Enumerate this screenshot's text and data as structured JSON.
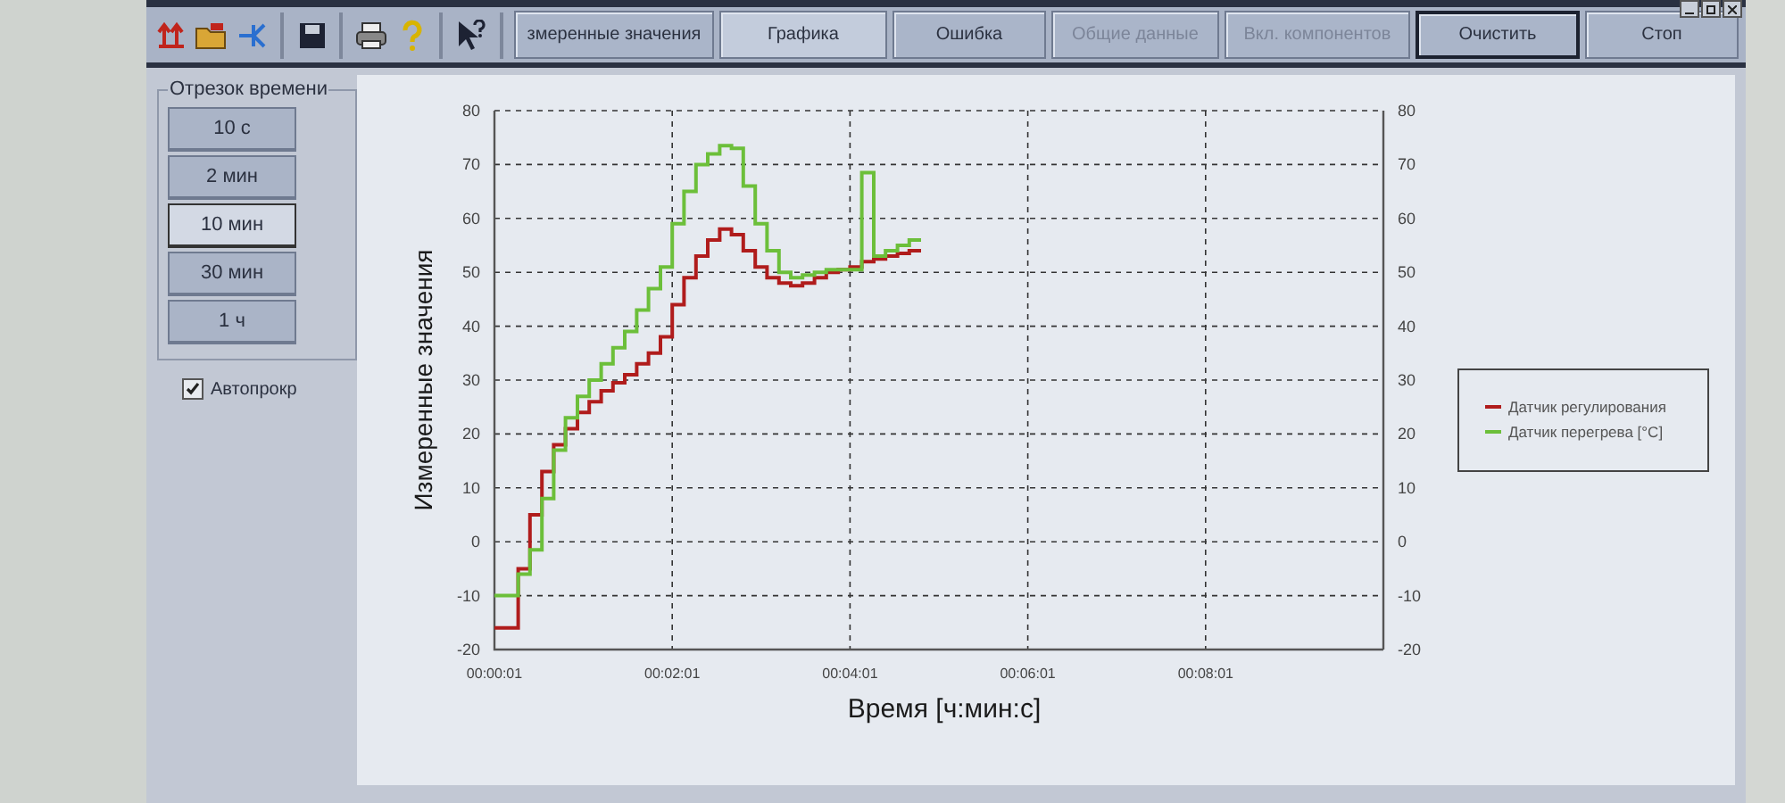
{
  "toolbar": {
    "tabs": [
      {
        "label": "змеренные значения",
        "selected": false,
        "disabled": false,
        "focused": false
      },
      {
        "label": "Графика",
        "selected": true,
        "disabled": false,
        "focused": false
      },
      {
        "label": "Ошибка",
        "selected": false,
        "disabled": false,
        "focused": false
      },
      {
        "label": "Общие данные",
        "selected": false,
        "disabled": true,
        "focused": false
      },
      {
        "label": "Вкл. компонентов",
        "selected": false,
        "disabled": true,
        "focused": false
      },
      {
        "label": "Очистить",
        "selected": false,
        "disabled": false,
        "focused": true
      },
      {
        "label": "Стоп",
        "selected": false,
        "disabled": false,
        "focused": false
      }
    ]
  },
  "time_range": {
    "title": "Отрезок времени",
    "options": [
      {
        "label": "10 с",
        "selected": false
      },
      {
        "label": "2 мин",
        "selected": false
      },
      {
        "label": "10 мин",
        "selected": true
      },
      {
        "label": "30 мин",
        "selected": false
      },
      {
        "label": "1 ч",
        "selected": false
      }
    ],
    "autoscroll": {
      "label": "Автопрокр",
      "checked": true
    }
  },
  "chart": {
    "chart_data": {
      "type": "line",
      "xlabel": "Время [ч:мин:с]",
      "ylabel": "Измеренные значения",
      "x": [
        1,
        9,
        9,
        17,
        17,
        25,
        25,
        33,
        33,
        41,
        41,
        49,
        49,
        57,
        57,
        65,
        65,
        73,
        73,
        81,
        81,
        89,
        89,
        97,
        97,
        105,
        105,
        113,
        113,
        121,
        121,
        129,
        129,
        137,
        137,
        145,
        145,
        153,
        153,
        161,
        161,
        169,
        169,
        177,
        177,
        185,
        185,
        193,
        193,
        201,
        201,
        209,
        209,
        217,
        217,
        225,
        225,
        233,
        233,
        241,
        241,
        249,
        249,
        257,
        257,
        265,
        265,
        273,
        273,
        281,
        281,
        289
      ],
      "series": [
        {
          "name": "Датчик регулирования",
          "color": "#b01c1c",
          "values": [
            -16,
            -16,
            -16,
            -16,
            -5,
            -5,
            5,
            5,
            13,
            13,
            18,
            18,
            21,
            21,
            24,
            24,
            26,
            26,
            28,
            28,
            29.5,
            29.5,
            31,
            31,
            33,
            33,
            35,
            35,
            38,
            38,
            44,
            44,
            49,
            49,
            53,
            53,
            56,
            56,
            58,
            58,
            57,
            57,
            54,
            54,
            51,
            51,
            49,
            49,
            48,
            48,
            47.5,
            47.5,
            48,
            48,
            49,
            49,
            50,
            50,
            50.5,
            50.5,
            51,
            51,
            52,
            52,
            52.5,
            52.5,
            53,
            53,
            53.5,
            53.5,
            54,
            54
          ]
        },
        {
          "name": "Датчик перегрева [°C]",
          "color": "#6cbf3a",
          "values": [
            -10,
            -10,
            -10,
            -10,
            -6,
            -6,
            -1.5,
            -1.5,
            8,
            8,
            17,
            17,
            23,
            23,
            27,
            27,
            30,
            30,
            33,
            33,
            36,
            36,
            39,
            39,
            43,
            43,
            47,
            47,
            51,
            51,
            59,
            59,
            65,
            65,
            70,
            70,
            72,
            72,
            73.5,
            73.5,
            73,
            73,
            66,
            66,
            59,
            59,
            54,
            54,
            50,
            50,
            49,
            49,
            49.5,
            49.5,
            50,
            50,
            50.5,
            50.5,
            50.5,
            50.5,
            50.5,
            50.5,
            68.5,
            68.5,
            53,
            53,
            54,
            54,
            55,
            55,
            56,
            56
          ]
        }
      ],
      "grid": true,
      "legend": true,
      "xlim": [
        1,
        601
      ],
      "ylim": [
        -20,
        80
      ],
      "xticks": [
        {
          "value": 1,
          "label": "00:00:01"
        },
        {
          "value": 121,
          "label": "00:02:01"
        },
        {
          "value": 241,
          "label": "00:04:01"
        },
        {
          "value": 361,
          "label": "00:06:01"
        },
        {
          "value": 481,
          "label": "00:08:01"
        }
      ],
      "yticks": [
        -20,
        -10,
        0,
        10,
        20,
        30,
        40,
        50,
        60,
        70,
        80
      ]
    },
    "right_axis_labels": [
      "80",
      "70",
      "60",
      "50",
      "40",
      "30",
      "20",
      "10",
      "0",
      "-10",
      "-20"
    ]
  }
}
